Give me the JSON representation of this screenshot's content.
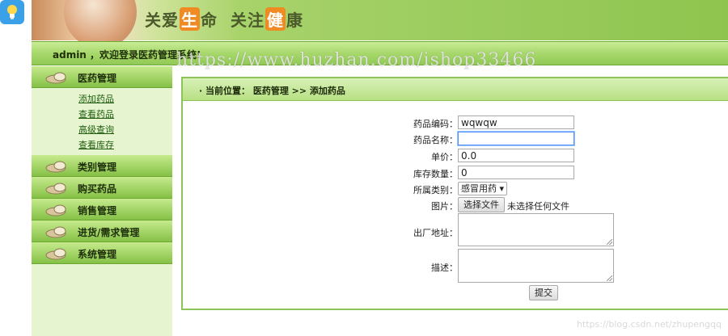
{
  "banner": {
    "slogan_part1": "关爱",
    "slogan_hl1": "生",
    "slogan_part2": "命",
    "slogan_part3": "关注",
    "slogan_hl2": "健",
    "slogan_part4": "康"
  },
  "welcome": {
    "text": "admin ，欢迎登录医药管理系统!"
  },
  "watermark": {
    "main": "https://www.huzhan.com/ishop33466",
    "corner": "https://blog.csdn.net/zhupengqq"
  },
  "sidebar": {
    "sections": [
      {
        "label": "医药管理",
        "items": [
          "添加药品",
          "查看药品",
          "高级查询",
          "查看库存"
        ]
      },
      {
        "label": "类别管理"
      },
      {
        "label": "购买药品"
      },
      {
        "label": "销售管理"
      },
      {
        "label": "进货/需求管理"
      },
      {
        "label": "系统管理"
      }
    ]
  },
  "breadcrumb": {
    "text": "· 当前位置： 医药管理 >> 添加药品"
  },
  "form": {
    "code_label": "药品编码：",
    "code_value": "wqwqw",
    "name_label": "药品名称：",
    "name_value": "",
    "price_label": "单价：",
    "price_value": "0.0",
    "stock_label": "库存数量：",
    "stock_value": "0",
    "category_label": "所属类别：",
    "category_value": "感冒用药 ▾",
    "image_label": "图片：",
    "choose_file": "选择文件",
    "no_file": "未选择任何文件",
    "origin_label": "出厂地址：",
    "desc_label": "描述：",
    "submit": "提交"
  },
  "colors": {
    "accent_green": "#8dc459",
    "header_green": "#a2d466",
    "sidebar_bg": "#e6f5cf",
    "highlight_orange": "#f08a22"
  }
}
